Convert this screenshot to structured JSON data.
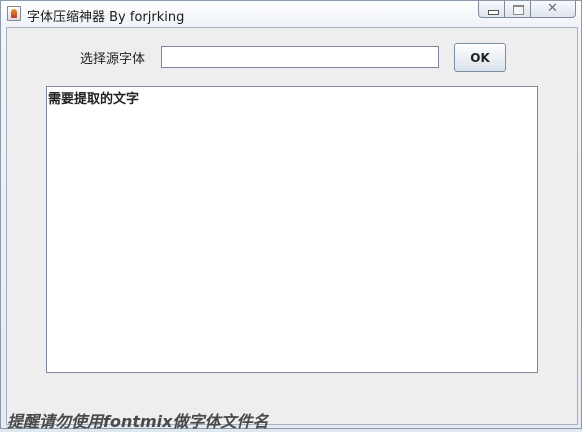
{
  "window": {
    "title": "字体压缩神器 By forjrking"
  },
  "form": {
    "source_font_label": "选择源字体",
    "source_font_value": "",
    "ok_label": "OK",
    "text_area_value": "需要提取的文字"
  },
  "footer": {
    "hint": "提醒请勿使用fontmix做字体文件名"
  },
  "icons": {
    "app": "java-cup-icon",
    "minimize": "minimize-icon",
    "maximize": "maximize-icon",
    "close": "close-icon"
  }
}
